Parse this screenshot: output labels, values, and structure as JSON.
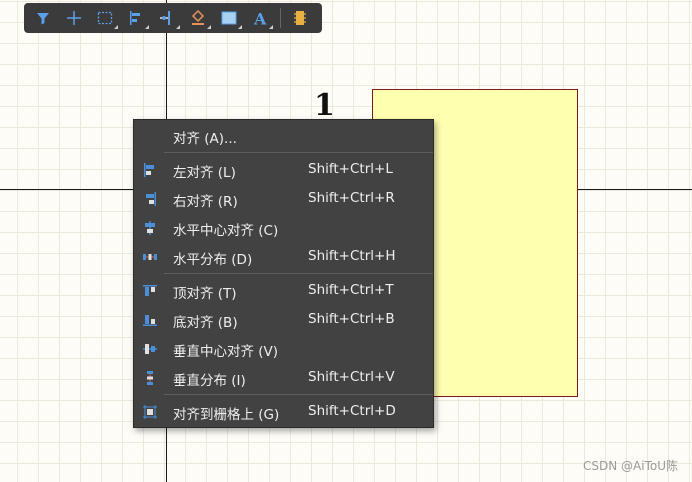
{
  "canvas": {
    "pin_number": "1"
  },
  "toolbar": {
    "buttons": [
      {
        "name": "filter-icon"
      },
      {
        "name": "crosshair-icon"
      },
      {
        "name": "selection-rect-icon"
      },
      {
        "name": "align-icon"
      },
      {
        "name": "pin-icon"
      },
      {
        "name": "fill-icon"
      },
      {
        "name": "rectangle-icon"
      },
      {
        "name": "text-icon"
      },
      {
        "name": "component-icon"
      }
    ]
  },
  "menu": {
    "header": "对齐 (A)...",
    "items": [
      {
        "label": "左对齐 (L)",
        "shortcut": "Shift+Ctrl+L"
      },
      {
        "label": "右对齐 (R)",
        "shortcut": "Shift+Ctrl+R"
      },
      {
        "label": "水平中心对齐 (C)",
        "shortcut": ""
      },
      {
        "label": "水平分布 (D)",
        "shortcut": "Shift+Ctrl+H"
      },
      {
        "label": "顶对齐 (T)",
        "shortcut": "Shift+Ctrl+T"
      },
      {
        "label": "底对齐 (B)",
        "shortcut": "Shift+Ctrl+B"
      },
      {
        "label": "垂直中心对齐 (V)",
        "shortcut": ""
      },
      {
        "label": "垂直分布 (I)",
        "shortcut": "Shift+Ctrl+V"
      },
      {
        "label": "对齐到栅格上 (G)",
        "shortcut": "Shift+Ctrl+D"
      }
    ]
  },
  "watermark": "CSDN @AiToU陈",
  "colors": {
    "accent": "#4a8fd8",
    "component_fill": "#ffffb0",
    "menu_bg": "#424242"
  }
}
